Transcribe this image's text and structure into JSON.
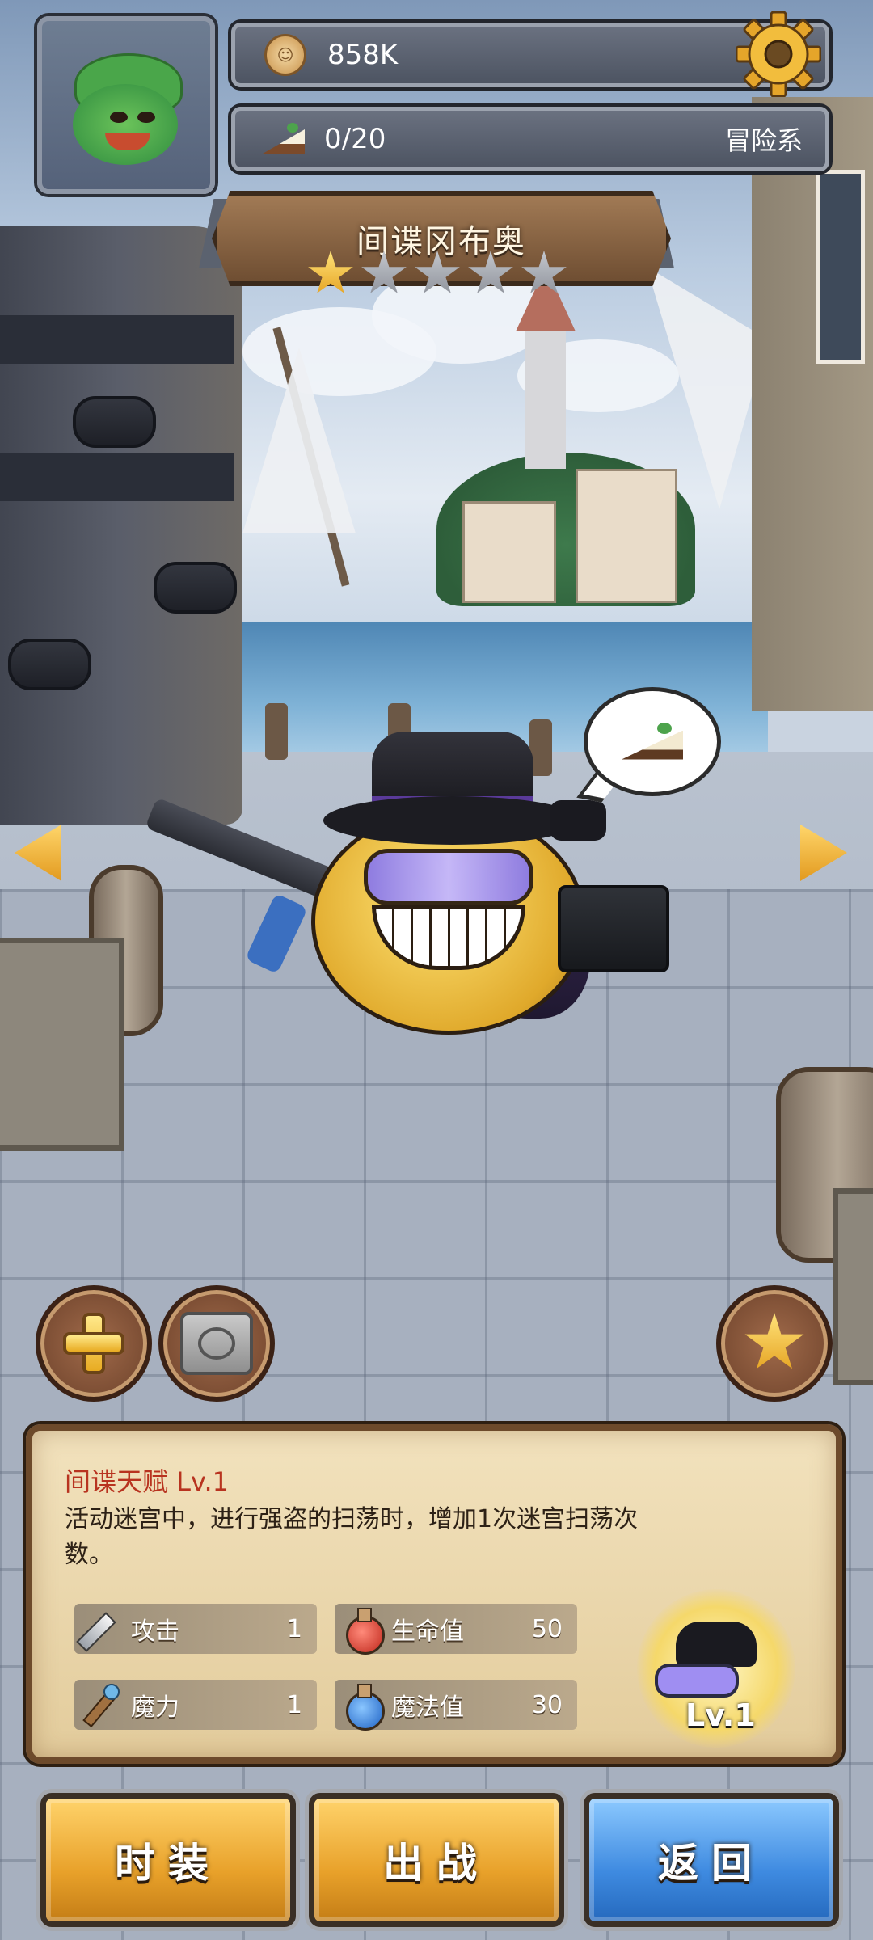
{
  "hud": {
    "coins": "858K",
    "cake_count": "0/20",
    "category": "冒险系"
  },
  "character": {
    "name": "间谍冈布奥",
    "stars_filled": 1,
    "stars_total": 5
  },
  "talent": {
    "title": "间谍天赋 Lv.1",
    "description": "活动迷宫中，进行强盗的扫荡时，增加1次迷宫扫荡次数。"
  },
  "stats": [
    {
      "label": "攻击",
      "value": "1",
      "icon": "sword-icon"
    },
    {
      "label": "生命值",
      "value": "50",
      "icon": "red-potion-icon"
    },
    {
      "label": "魔力",
      "value": "1",
      "icon": "magic-staff-icon"
    },
    {
      "label": "魔法值",
      "value": "30",
      "icon": "blue-potion-icon"
    }
  ],
  "skill": {
    "level": "Lv.1"
  },
  "buttons": {
    "costume": "时装",
    "deploy": "出战",
    "back": "返回"
  },
  "colors": {
    "accent_gold": "#e8a12a",
    "accent_blue": "#3e8ae0",
    "talent_title": "#b8331f"
  }
}
